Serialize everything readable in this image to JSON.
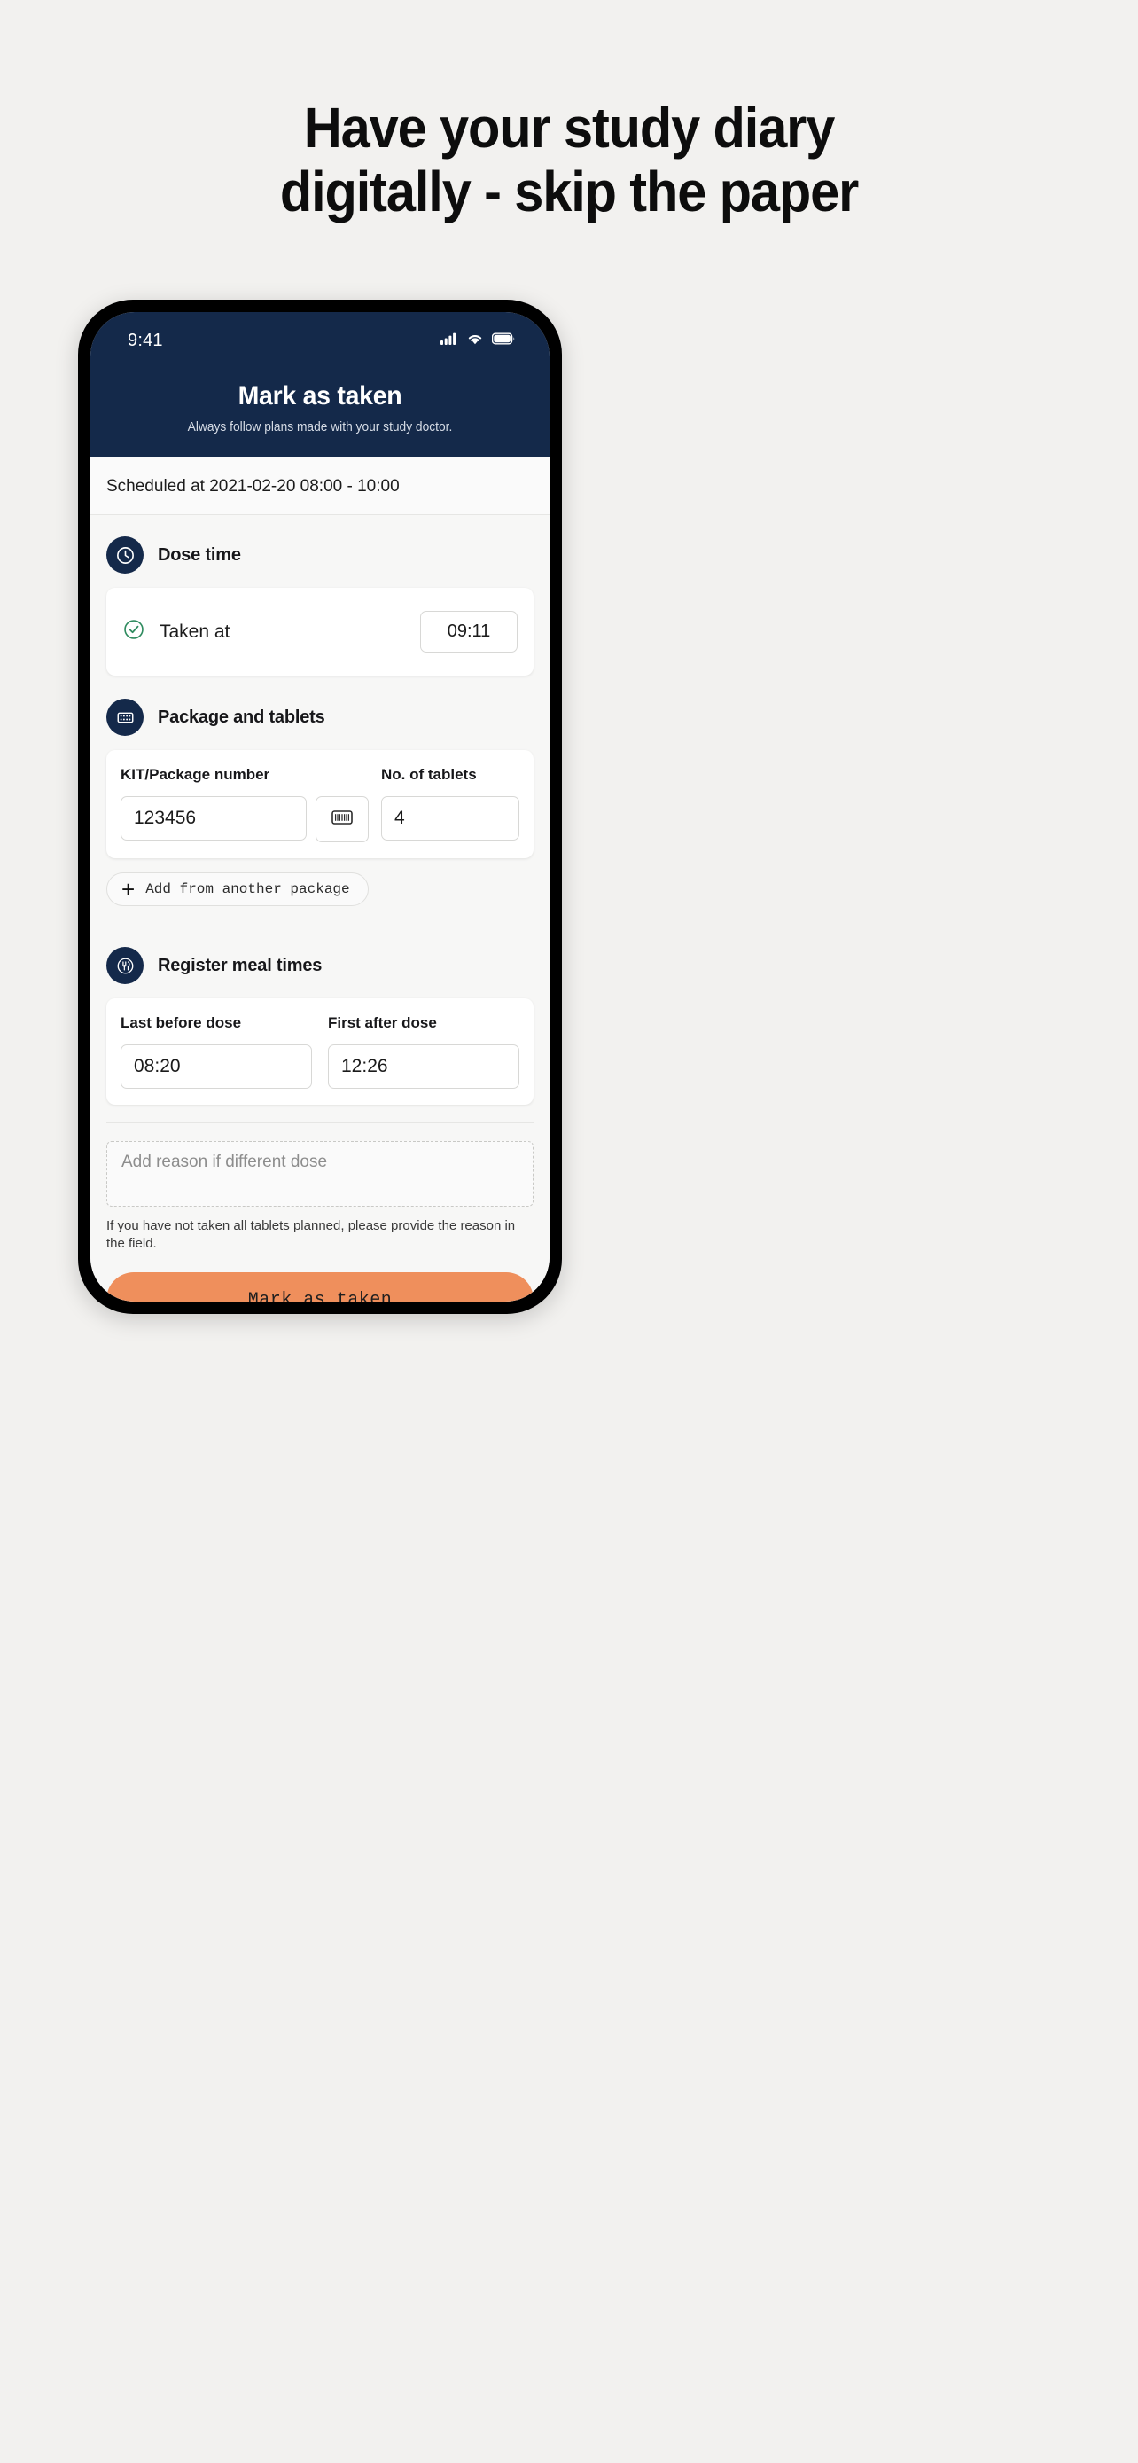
{
  "marketing": {
    "headline_line1": "Have your study diary",
    "headline_line2": "digitally - skip the paper"
  },
  "status_bar": {
    "time": "9:41",
    "cellular_icon": "cellular-signal-icon",
    "wifi_icon": "wifi-icon",
    "battery_icon": "battery-icon"
  },
  "app_header": {
    "title": "Mark as taken",
    "subtitle": "Always follow plans made with your study doctor."
  },
  "scheduled": {
    "text": "Scheduled at 2021-02-20 08:00 - 10:00"
  },
  "dose_time_section": {
    "icon": "clock-icon",
    "title": "Dose time",
    "taken_icon": "check-circle-icon",
    "taken_label": "Taken at",
    "taken_value": "09:11"
  },
  "package_section": {
    "icon": "blister-pack-icon",
    "title": "Package and tablets",
    "kit_label": "KIT/Package number",
    "kit_value": "123456",
    "scan_icon": "barcode-scan-icon",
    "tablets_label": "No. of tablets",
    "tablets_value": "4",
    "add_package_icon": "plus-icon",
    "add_package_label": "Add from another package"
  },
  "meal_section": {
    "icon": "cutlery-icon",
    "title": "Register meal times",
    "last_before_label": "Last before dose",
    "last_before_value": "08:20",
    "first_after_label": "First after dose",
    "first_after_value": "12:26"
  },
  "reason": {
    "placeholder": "Add reason if different dose",
    "helper": "If you have not taken all tablets planned, please provide the reason in the field."
  },
  "cta": {
    "label": "Mark as taken"
  },
  "colors": {
    "page_background": "#f2f1ef",
    "header_navy": "#14294a",
    "accent_orange": "#ef8f5c",
    "success_green": "#2f8b5f",
    "card_white": "#ffffff",
    "content_background": "#f7f7f6"
  }
}
